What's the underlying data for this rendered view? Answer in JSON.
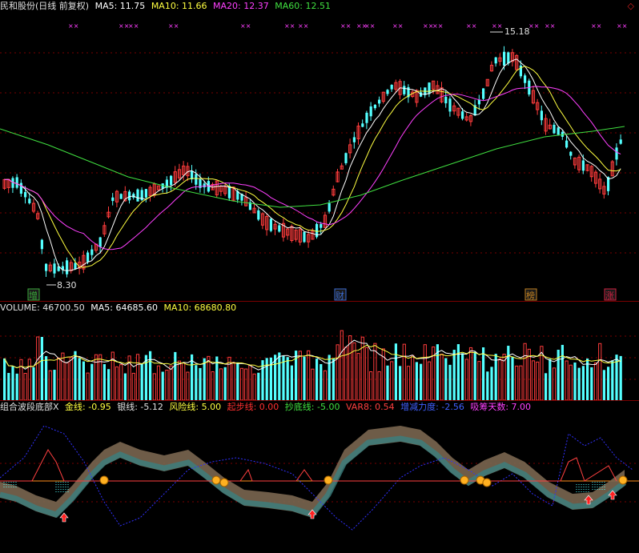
{
  "header": {
    "stock_name": "民和股份(日线 前复权)",
    "ma5": "MA5: 11.75",
    "ma10": "MA10: 11.66",
    "ma20": "MA20: 12.37",
    "ma60": "MA60: 12.51",
    "toolbar_icon": "◇"
  },
  "price_panel": {
    "high_label": "15.18",
    "low_label": "8.30",
    "markers": [
      "增",
      "财",
      "榜",
      "涨"
    ],
    "marker_colors": [
      "#3aaa3a",
      "#3a6ad0",
      "#c08020",
      "#d02040"
    ]
  },
  "volume_panel": {
    "volume": "VOLUME: 46700.50",
    "ma5": "MA5: 64685.60",
    "ma10": "MA10: 68680.80"
  },
  "indicator_panel": {
    "title": "组合波段底部X",
    "gold_line": "金线: -0.95",
    "silver_line": "银线: -5.12",
    "risk_line": "风险线: 5.00",
    "start_line": "起步线: 0.00",
    "bottom_line": "抄底线: -5.00",
    "var8": "VAR8: 0.54",
    "increase_force": "增减力度: -2.56",
    "absorb_days": "吸筹天数: 7.00"
  },
  "colors": {
    "up": "#ff3c3c",
    "down": "#54ffff",
    "ma5": "#ffffff",
    "ma10": "#ffff40",
    "ma20": "#ff40ff",
    "ma60": "#40e040",
    "grid": "#7a0000",
    "purple_x": "#ff40ff"
  }
}
